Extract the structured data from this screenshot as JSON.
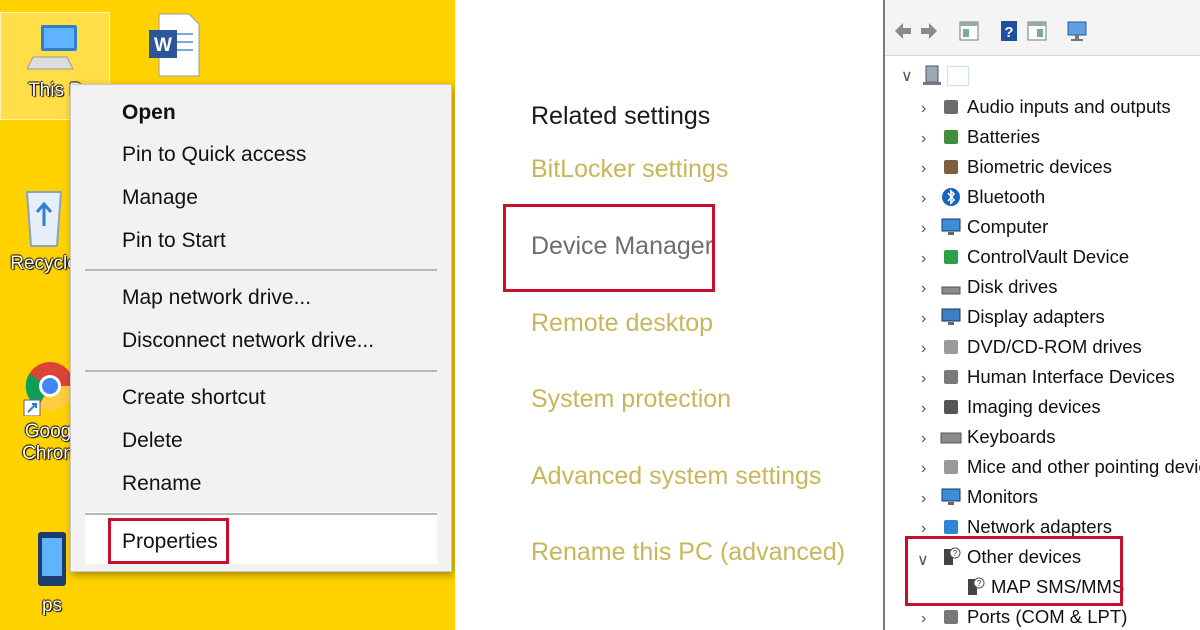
{
  "desktop": {
    "icons": [
      {
        "label": "This P",
        "icon": "this-pc-icon"
      },
      {
        "label": "",
        "icon": "word-document-icon"
      },
      {
        "label": "Recycle",
        "icon": "recycle-bin-icon"
      },
      {
        "label": "Goog",
        "label2": "Chron",
        "icon": "chrome-icon"
      },
      {
        "label": "ps",
        "icon": "shortcut-icon"
      }
    ],
    "background_color": "#ffd200"
  },
  "context_menu": {
    "items": [
      {
        "label": "Open",
        "bold": true
      },
      {
        "label": "Pin to Quick access"
      },
      {
        "label": "Manage"
      },
      {
        "label": "Pin to Start"
      },
      {
        "label": "Map network drive..."
      },
      {
        "label": "Disconnect network drive..."
      },
      {
        "label": "Create shortcut"
      },
      {
        "label": "Delete"
      },
      {
        "label": "Rename"
      },
      {
        "label": "Properties",
        "highlighted": true
      }
    ]
  },
  "related_settings": {
    "heading": "Related settings",
    "links": [
      {
        "label": "BitLocker settings"
      },
      {
        "label": "Device Manager",
        "highlighted": true
      },
      {
        "label": "Remote desktop"
      },
      {
        "label": "System protection"
      },
      {
        "label": "Advanced system settings"
      },
      {
        "label": "Rename this PC (advanced)"
      }
    ],
    "link_color": "#c9b65a"
  },
  "device_manager": {
    "toolbar": [
      "back-arrow-icon",
      "forward-arrow-icon",
      "properties-icon",
      "help-icon",
      "update-driver-icon",
      "scan-hardware-icon"
    ],
    "categories": [
      {
        "label": "Audio inputs and outputs",
        "icon": "speaker-icon"
      },
      {
        "label": "Batteries",
        "icon": "battery-icon"
      },
      {
        "label": "Biometric devices",
        "icon": "biometric-icon"
      },
      {
        "label": "Bluetooth",
        "icon": "bluetooth-icon"
      },
      {
        "label": "Computer",
        "icon": "computer-icon"
      },
      {
        "label": "ControlVault Device",
        "icon": "controlvault-icon"
      },
      {
        "label": "Disk drives",
        "icon": "disk-drive-icon"
      },
      {
        "label": "Display adapters",
        "icon": "display-adapter-icon"
      },
      {
        "label": "DVD/CD-ROM drives",
        "icon": "dvd-drive-icon"
      },
      {
        "label": "Human Interface Devices",
        "icon": "hid-icon"
      },
      {
        "label": "Imaging devices",
        "icon": "camera-icon"
      },
      {
        "label": "Keyboards",
        "icon": "keyboard-icon"
      },
      {
        "label": "Mice and other pointing devices",
        "icon": "mouse-icon"
      },
      {
        "label": "Monitors",
        "icon": "monitor-icon"
      },
      {
        "label": "Network adapters",
        "icon": "network-adapter-icon"
      },
      {
        "label": "Other devices",
        "icon": "unknown-device-icon",
        "expanded": true,
        "highlighted": true
      },
      {
        "label": "MAP SMS/MMS",
        "icon": "unknown-device-icon",
        "child": true,
        "highlighted": true
      },
      {
        "label": "Ports (COM & LPT)",
        "icon": "port-icon"
      }
    ]
  },
  "colors": {
    "highlight_box": "#c8102e"
  }
}
